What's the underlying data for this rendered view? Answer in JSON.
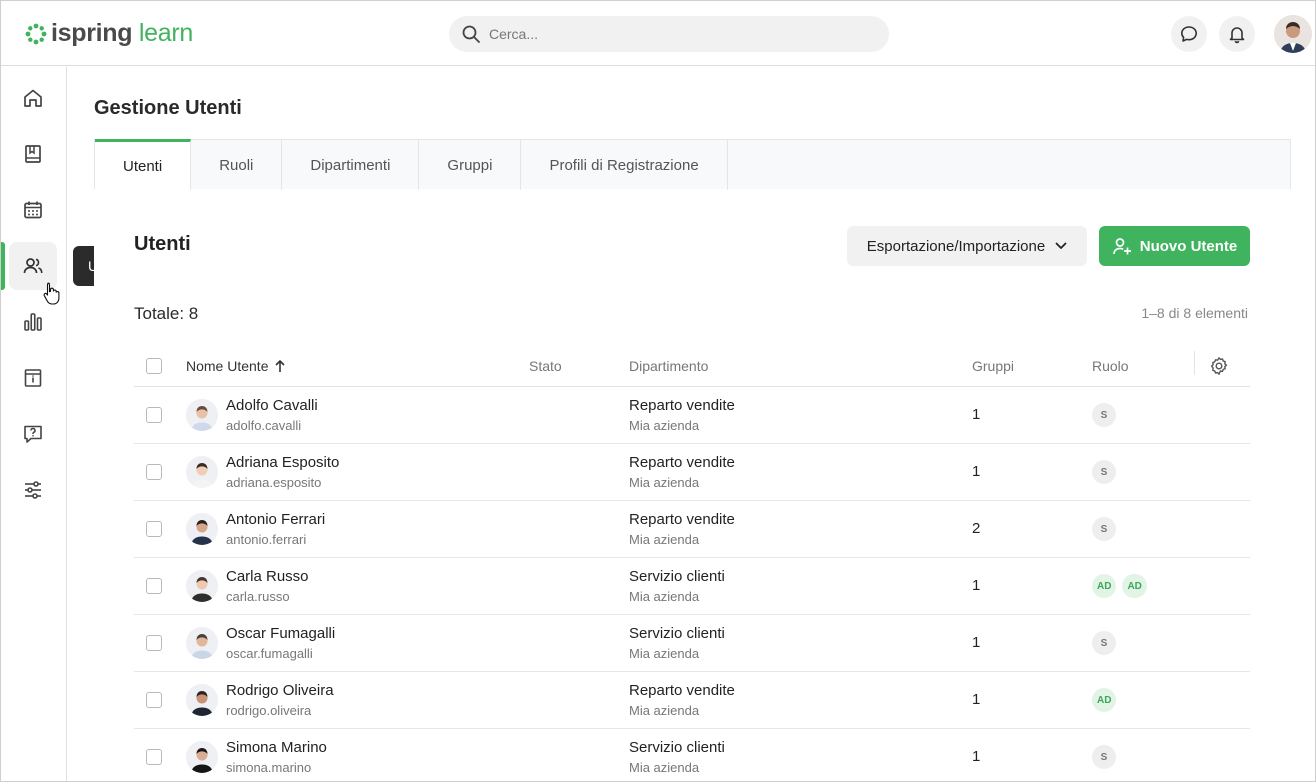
{
  "header": {
    "logo_main": "ispring",
    "logo_accent": "learn",
    "search_placeholder": "Cerca..."
  },
  "sidebar": {
    "items": [
      {
        "name": "home-icon"
      },
      {
        "name": "book-icon"
      },
      {
        "name": "calendar-icon"
      },
      {
        "name": "users-icon"
      },
      {
        "name": "chart-icon"
      },
      {
        "name": "info-icon"
      },
      {
        "name": "question-icon"
      },
      {
        "name": "settings-sliders-icon"
      }
    ],
    "tooltip": "Utenti"
  },
  "page": {
    "title": "Gestione Utenti",
    "tabs": [
      "Utenti",
      "Ruoli",
      "Dipartimenti",
      "Gruppi",
      "Profili di Registrazione"
    ],
    "section_title": "Utenti",
    "export_button": "Esportazione/Importazione",
    "new_user_button": "Nuovo Utente",
    "total": "Totale: 8",
    "range": "1–8 di 8 elementi"
  },
  "table": {
    "columns": [
      "Nome Utente",
      "Stato",
      "Dipartimento",
      "Gruppi",
      "Ruolo"
    ],
    "rows": [
      {
        "name": "Adolfo Cavalli",
        "login": "adolfo.cavalli",
        "dept": "Reparto vendite",
        "company": "Mia azienda",
        "groups": "1",
        "roles": [
          "S"
        ]
      },
      {
        "name": "Adriana Esposito",
        "login": "adriana.esposito",
        "dept": "Reparto vendite",
        "company": "Mia azienda",
        "groups": "1",
        "roles": [
          "S"
        ]
      },
      {
        "name": "Antonio Ferrari",
        "login": "antonio.ferrari",
        "dept": "Reparto vendite",
        "company": "Mia azienda",
        "groups": "2",
        "roles": [
          "S"
        ]
      },
      {
        "name": "Carla Russo",
        "login": "carla.russo",
        "dept": "Servizio clienti",
        "company": "Mia azienda",
        "groups": "1",
        "roles": [
          "AD",
          "AD"
        ]
      },
      {
        "name": "Oscar Fumagalli",
        "login": "oscar.fumagalli",
        "dept": "Servizio clienti",
        "company": "Mia azienda",
        "groups": "1",
        "roles": [
          "S"
        ]
      },
      {
        "name": "Rodrigo Oliveira",
        "login": "rodrigo.oliveira",
        "dept": "Reparto vendite",
        "company": "Mia azienda",
        "groups": "1",
        "roles": [
          "AD"
        ]
      },
      {
        "name": "Simona Marino",
        "login": "simona.marino",
        "dept": "Servizio clienti",
        "company": "Mia azienda",
        "groups": "1",
        "roles": [
          "S"
        ]
      }
    ]
  },
  "colors": {
    "accent": "#3fb35e",
    "tooltip_bg": "#2b2b2b"
  }
}
